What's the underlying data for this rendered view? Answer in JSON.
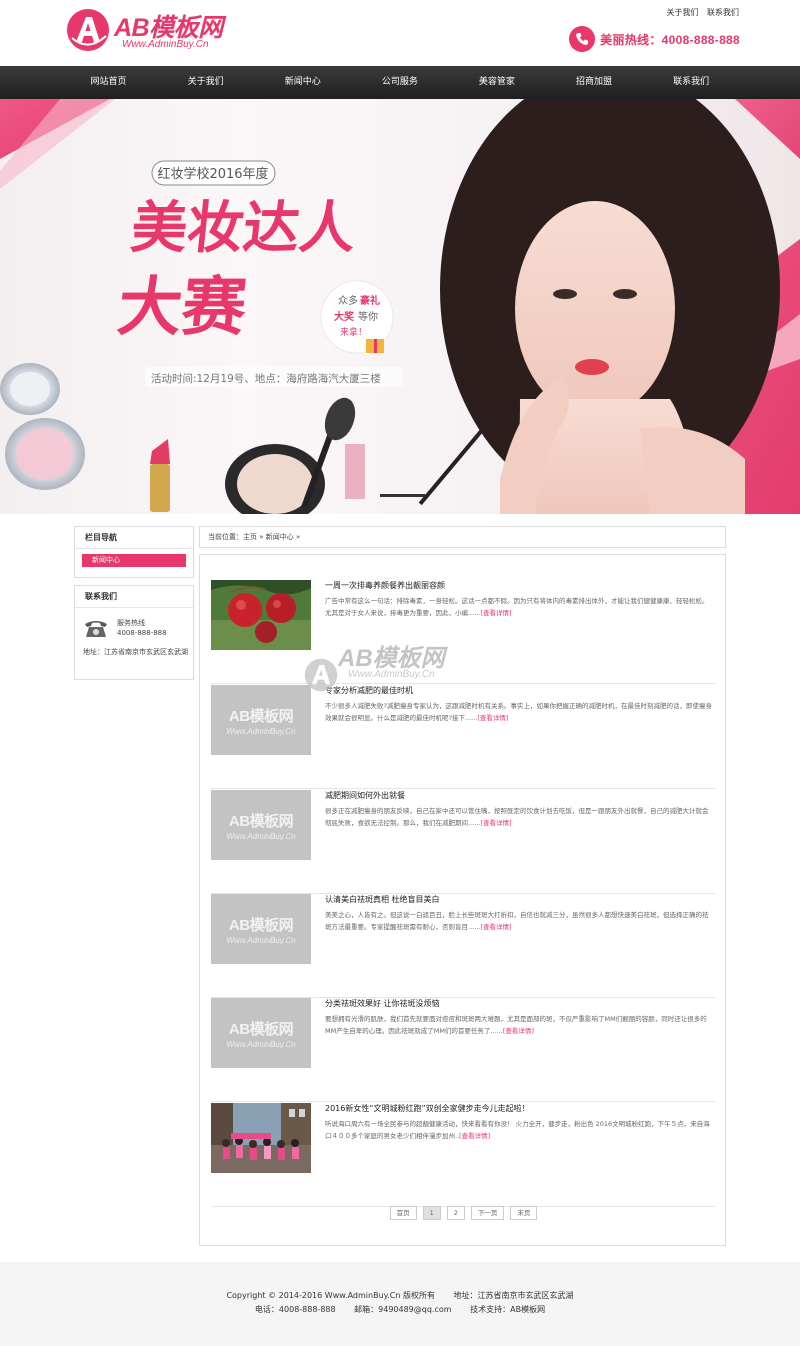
{
  "header": {
    "logo_text": "AB模板网",
    "logo_sub": "Www.AdminBuy.Cn",
    "top_links": [
      "关于我们",
      "联系我们"
    ],
    "hotline_label": "美丽热线：4008-888-888"
  },
  "nav": {
    "items": [
      "网站首页",
      "关于我们",
      "新闻中心",
      "公司服务",
      "美容管家",
      "招商加盟",
      "联系我们"
    ]
  },
  "banner": {
    "top_badge": "红妆学校2016年度",
    "headline_1": "美妆达人",
    "headline_2": "大赛",
    "tag_1": "众多",
    "tag_2": "豪礼",
    "tag_3": "大奖",
    "tag_4": "等你",
    "tag_5": "来拿！",
    "event_info": "活动时间:12月19号、地点：海府路海汽大厦三楼"
  },
  "sidebar": {
    "nav_title": "栏目导航",
    "nav_item": "新闻中心",
    "contact_title": "联系我们",
    "contact_label": "服务热线",
    "contact_phone": "4008-888-888",
    "contact_address": "地址：江苏省南京市玄武区玄武湖"
  },
  "breadcrumb": "当前位置：主页 » 新闻中心 »",
  "news": [
    {
      "title": "一周一次排毒养颜餐养出靓丽容颜",
      "desc": "广告中常有这么一句话：排除毒素，一身轻松。这话一点都不假。因为只有将体内的毒素排出体外，才能让我们健健康康、轻轻松松。尤其是对于女人来说，排毒更为重要，因此，小编......",
      "more": "[查看详情]"
    },
    {
      "title": "专家分析减肥的最佳时机",
      "desc": "不少很多人减肥失败?减肥瘦身专家认为，这跟减肥时机有关系。事实上，如果你把握正确的减肥时机，在最佳时刻减肥的话，即使瘦身效果就会很明显。什么是减肥的最佳时机呢?接下......",
      "more": "[查看详情]"
    },
    {
      "title": "减肥期间如何外出就餐",
      "desc": "很多正在减肥瘦身的朋友反映，自己在家中还可以管住嘴，按照既定的饮食计划去吃饭，但是一跟朋友外出就餐，自己的减肥大计就会彻底失败，食欲无法控制。那么，我们在减肥期间......",
      "more": "[查看详情]"
    },
    {
      "title": "认清美白祛斑真相 杜绝盲目美白",
      "desc": "美美之心，人皆有之。但这说一白遮百丑，脸上长些斑斑大打折扣，自信也就减三分，虽然很多人都想快速美白祛斑，但选择正确的祛斑方法最重要。专家提醒祛斑需有耐心，否则盲目......",
      "more": "[查看详情]"
    },
    {
      "title": "分类祛斑效果好 让你祛斑没烦恼",
      "desc": "要想拥有光滑的肌肤，我们首先就要面对痘痘和斑斑两大难题，尤其是面部的斑，不仅严重影响了MM们靓丽的容颜，同时还让很多的MM产生自卑的心理。因此祛斑就成了MM们的首要任务了......",
      "more": "[查看详情]"
    },
    {
      "title": "2016新女性“文明城粉红跑”双创全家健步走今儿走起啦！",
      "desc": "听说海口周六有一场全民参与的超靓健康活动，快来看看有你没！ 火力全开，健步走，粉出色 2016文明城粉红跑，下午５点，来自海口４００多个家庭的男女老少们相伴漫步加州..",
      "more": "[查看详情]"
    }
  ],
  "placeholder_logo": "AB模板网",
  "placeholder_sub": "Www.AdminBuy.Cn",
  "pager": [
    "首页",
    "1",
    "2",
    "下一页",
    "末页"
  ],
  "footer": {
    "copyright": "Copyright © 2014-2016 Www.AdminBuy.Cn 版权所有",
    "address": "地址：江苏省南京市玄武区玄武湖",
    "phone": "电话：4008-888-888",
    "email": "邮箱：9490489@qq.com",
    "support": "技术支持：AB模板网"
  },
  "colors": {
    "accent": "#e8376a",
    "nav_bg": "#2a2a2a",
    "footer_bg": "#f5f5f5"
  }
}
